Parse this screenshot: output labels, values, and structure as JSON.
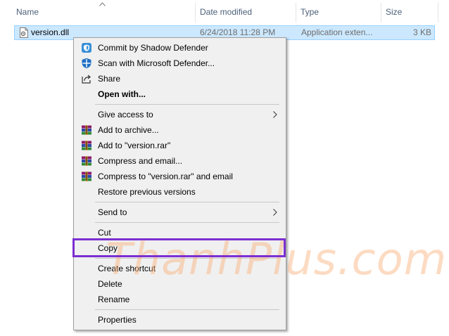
{
  "columns": {
    "name": "Name",
    "date_modified": "Date modified",
    "type": "Type",
    "size": "Size"
  },
  "file": {
    "name": "version.dll",
    "date_modified": "6/24/2018 11:28 PM",
    "type": "Application exten...",
    "size": "3 KB",
    "icon": "dll-file-icon"
  },
  "menu": {
    "commit_shadow": "Commit by Shadow Defender",
    "scan_defender": "Scan with Microsoft Defender...",
    "share": "Share",
    "open_with": "Open with...",
    "give_access": "Give access to",
    "add_archive": "Add to archive...",
    "add_rar": "Add to \"version.rar\"",
    "compress_email": "Compress and email...",
    "compress_rar_email": "Compress to \"version.rar\" and email",
    "restore_versions": "Restore previous versions",
    "send_to": "Send to",
    "cut": "Cut",
    "copy": "Copy",
    "create_shortcut": "Create shortcut",
    "delete": "Delete",
    "rename": "Rename",
    "properties": "Properties"
  },
  "highlight_color": "#7b2fd2",
  "watermark": "ThanhPlus.com"
}
